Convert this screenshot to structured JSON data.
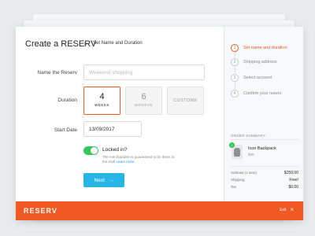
{
  "header": {
    "title": "Create a RESERV",
    "separator": "›",
    "breadcrumb": "Set Name and Duration"
  },
  "form": {
    "name_label": "Name the Reserv",
    "name_placeholder": "Weekend shopping",
    "duration_label": "Duration",
    "duration_options": [
      {
        "number": "4",
        "unit": "WEEKS",
        "selected": true
      },
      {
        "number": "6",
        "unit": "MONTHS",
        "selected": false
      },
      {
        "number": "",
        "unit": "CUSTOME",
        "selected": false
      }
    ],
    "start_label": "Start Date",
    "start_value": "13/09/2017",
    "locked_title": "Locked in?",
    "locked_desc": "The merchandise is guaranteed to be there at the end!",
    "learn_more": "Learn more",
    "locked_on": true,
    "next_label": "Next",
    "next_arrow": "→"
  },
  "steps": [
    {
      "num": "1",
      "label": "Set name and duration",
      "active": true
    },
    {
      "num": "2",
      "label": "Shipping address",
      "active": false
    },
    {
      "num": "3",
      "label": "Select account",
      "active": false
    },
    {
      "num": "4",
      "label": "Confirm your reserv",
      "active": false
    }
  ],
  "summary": {
    "heading": "ORDER SUMMARY",
    "qty": "1",
    "product_name": "Icon Backpack",
    "product_price": "$99",
    "subtotal_label": "Subtotal (1 item)",
    "subtotal_value": "$259.00",
    "shipping_label": "Shipping",
    "shipping_value": "Free!",
    "tax_label": "Tax",
    "tax_value": "$0.00"
  },
  "footer": {
    "brand": "RESERV",
    "exit_label": "Exit",
    "exit_icon": "×"
  },
  "colors": {
    "accent": "#f05a22",
    "primary_button": "#27b4e6",
    "toggle_on": "#35c759"
  }
}
